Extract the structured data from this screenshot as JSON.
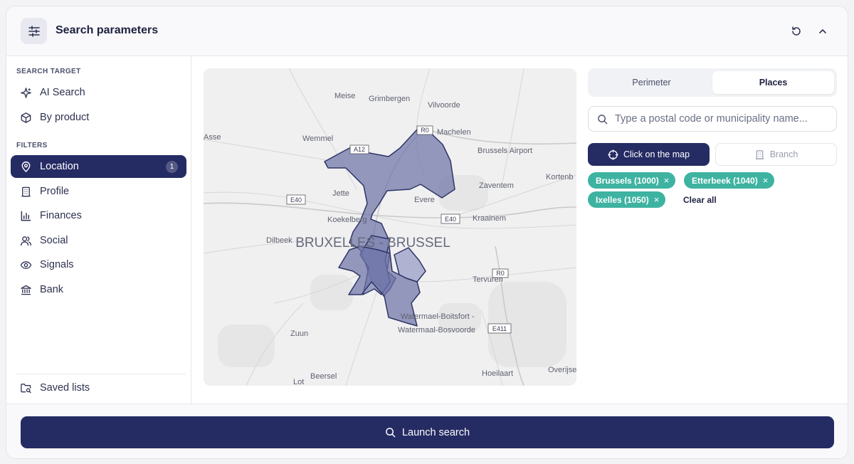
{
  "header": {
    "title": "Search parameters"
  },
  "sidebar": {
    "search_target_label": "Search target",
    "filters_label": "Filters",
    "target_items": [
      {
        "label": "AI Search",
        "icon": "sparkle-icon"
      },
      {
        "label": "By product",
        "icon": "box-icon"
      }
    ],
    "filter_items": [
      {
        "label": "Location",
        "icon": "map-pin-icon",
        "badge": "1",
        "active": true
      },
      {
        "label": "Profile",
        "icon": "building-icon"
      },
      {
        "label": "Finances",
        "icon": "bar-chart-icon"
      },
      {
        "label": "Social",
        "icon": "users-icon"
      },
      {
        "label": "Signals",
        "icon": "eye-icon"
      },
      {
        "label": "Bank",
        "icon": "bank-icon"
      }
    ],
    "saved_lists_label": "Saved lists"
  },
  "map": {
    "labels": {
      "meise": "Meise",
      "grimbergen": "Grimbergen",
      "vilvoorde": "Vilvoorde",
      "machelen": "Machelen",
      "asse": "Asse",
      "wemmel": "Wemmel",
      "brussels_airport": "Brussels Airport",
      "kortenberg": "Kortenb",
      "zaventem": "Zaventem",
      "jette": "Jette",
      "evere": "Evere",
      "koekelberg": "Koekelberg",
      "kraainem": "Kraainem",
      "dilbeek": "Dilbeek",
      "city": "BRUXELLES - BRUSSEL",
      "tervuren": "Tervuren",
      "watermael1": "Watermael-Boitsfort -",
      "watermael2": "Watermaal-Bosvoorde",
      "zuun": "Zuun",
      "beersel": "Beersel",
      "hoeilaart": "Hoeilaart",
      "overijse": "Overijse",
      "lot": "Lot"
    },
    "roads": {
      "a12": "A12",
      "r0_top": "R0",
      "e40_left": "E40",
      "e40_right": "E40",
      "r0_right": "R0",
      "e411": "E411"
    },
    "region_color": "#6f75a8"
  },
  "places": {
    "tabs": [
      "Perimeter",
      "Places"
    ],
    "active_tab": "Places",
    "search_placeholder": "Type a postal code or municipality name...",
    "click_map_label": "Click on the map",
    "branch_label": "Branch",
    "chips": [
      "Brussels (1000)",
      "Etterbeek (1040)",
      "Ixelles (1050)"
    ],
    "clear_all_label": "Clear all",
    "chip_color": "#3eb3a1"
  },
  "footer": {
    "launch_label": "Launch search"
  },
  "colors": {
    "primary": "#252b63",
    "accent": "#3eb3a1"
  }
}
